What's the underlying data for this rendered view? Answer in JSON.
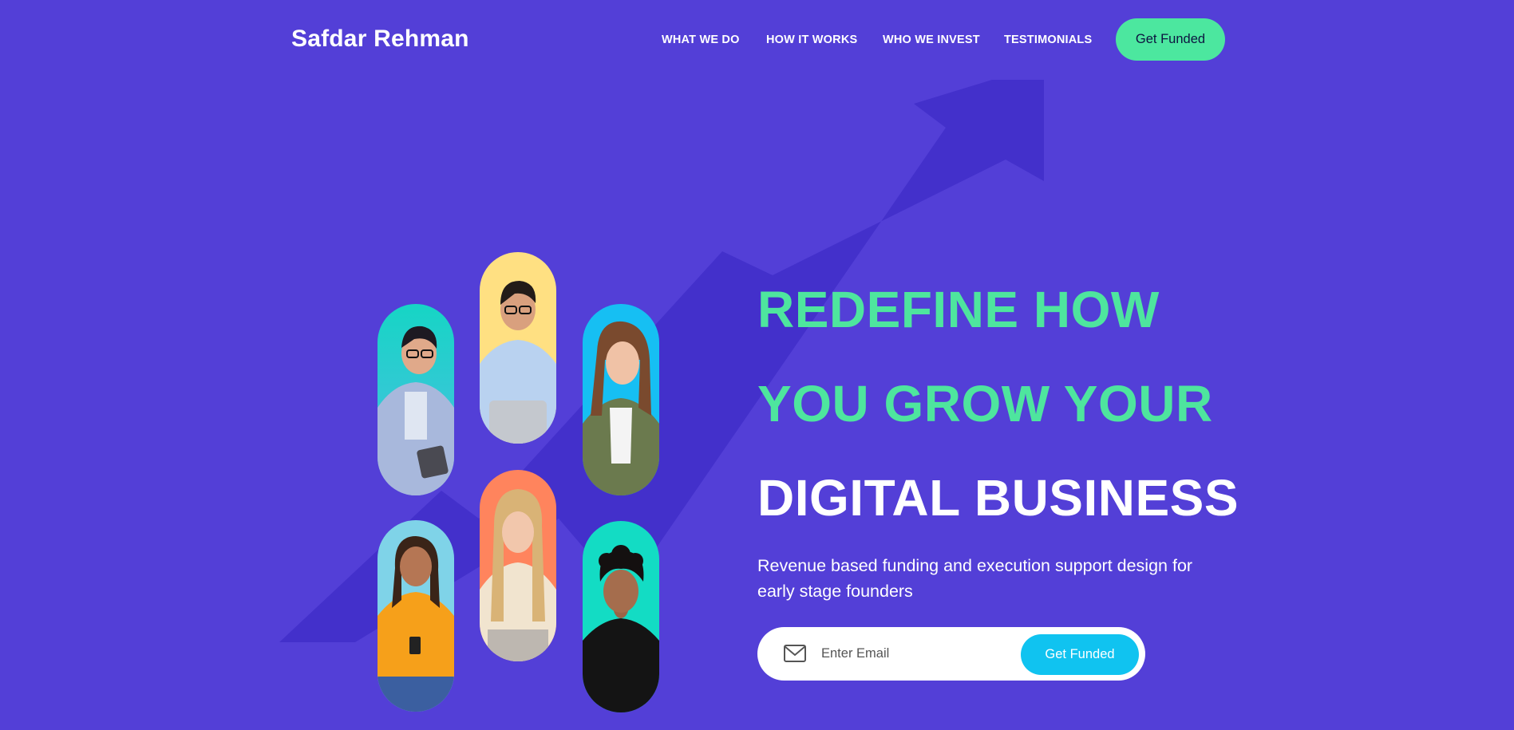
{
  "brand": {
    "name": "Safdar Rehman"
  },
  "nav": {
    "items": [
      {
        "label": "WHAT WE DO"
      },
      {
        "label": "HOW IT WORKS"
      },
      {
        "label": "WHO WE INVEST"
      },
      {
        "label": "TESTIMONIALS"
      }
    ],
    "cta_label": "Get Funded"
  },
  "hero": {
    "line1": "REDEFINE HOW",
    "line2": "YOU GROW YOUR",
    "line3": "DIGITAL BUSINESS",
    "subtitle": "Revenue based funding and execution support design for early stage founders"
  },
  "signup": {
    "placeholder": "Enter Email",
    "button_label": "Get Funded",
    "icon": "mail-icon"
  },
  "colors": {
    "background": "#533fd7",
    "accent_green": "#4ce79f",
    "cta_blue": "#10c3f0",
    "arrow": "#4330cb"
  }
}
